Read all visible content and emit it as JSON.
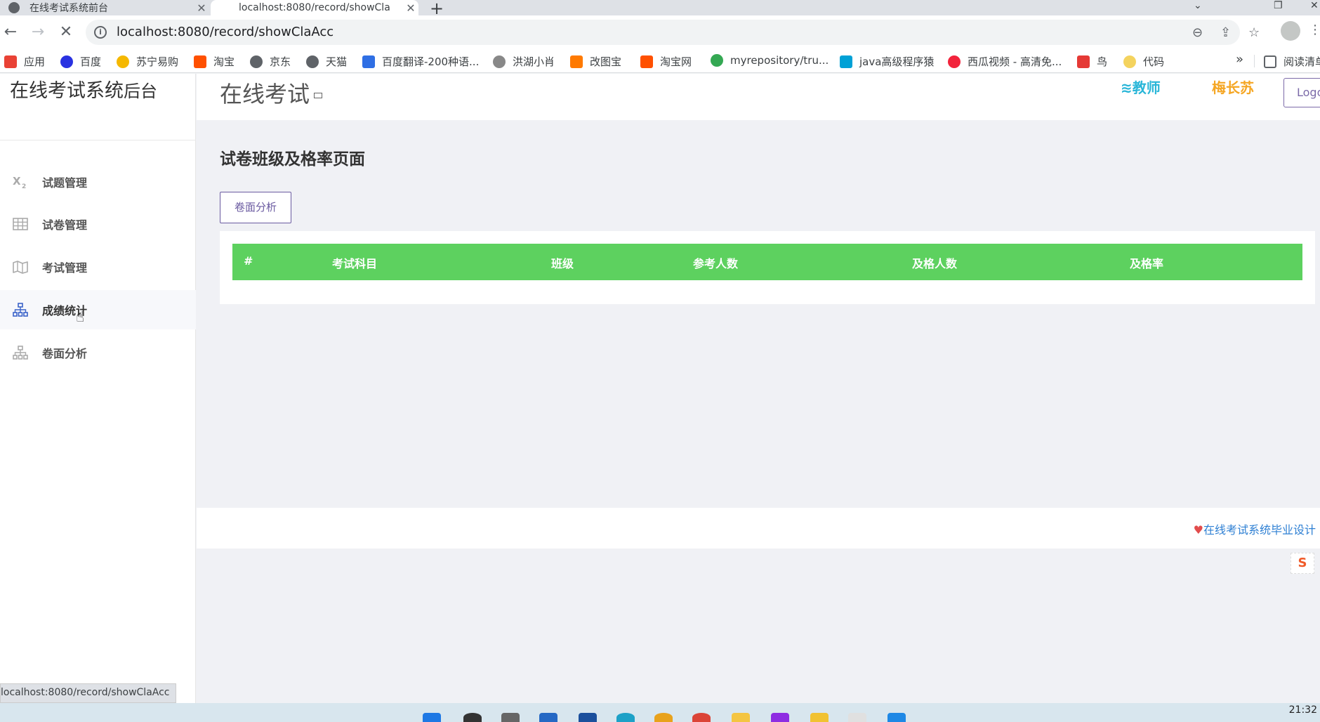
{
  "browser": {
    "tabs": [
      {
        "title": "在线考试系统前台",
        "active": false
      },
      {
        "title": "localhost:8080/record/showCla",
        "active": true
      }
    ],
    "url": "localhost:8080/record/showClaAcc",
    "bookmarks": [
      {
        "label": "应用",
        "color": "#e94235"
      },
      {
        "label": "百度",
        "color": "#2932e1"
      },
      {
        "label": "苏宁易购",
        "color": "#f5b800"
      },
      {
        "label": "淘宝",
        "color": "#ff5000"
      },
      {
        "label": "京东",
        "color": "#5f6368"
      },
      {
        "label": "天猫",
        "color": "#5f6368"
      },
      {
        "label": "百度翻译-200种语...",
        "color": "#2f6fe4"
      },
      {
        "label": "洪湖小肖",
        "color": "#888888"
      },
      {
        "label": "改图宝",
        "color": "#ff7a00"
      },
      {
        "label": "淘宝网",
        "color": "#ff5000"
      },
      {
        "label": "myrepository/tru...",
        "color": "#34a853"
      },
      {
        "label": "java高级程序猿",
        "color": "#00a1d6"
      },
      {
        "label": "西瓜视频 - 高清免...",
        "color": "#f2233b"
      },
      {
        "label": "鸟",
        "color": "#e53935"
      },
      {
        "label": "代码",
        "color": "#f4d35e"
      }
    ],
    "reading_list": "阅读清单",
    "status_url": "localhost:8080/record/showClaAcc"
  },
  "sidebar": {
    "brand": "在线考试系统",
    "brand_sub": "后台",
    "items": [
      {
        "label": "试题管理",
        "icon": "subscript-icon"
      },
      {
        "label": "试卷管理",
        "icon": "grid-icon"
      },
      {
        "label": "考试管理",
        "icon": "map-icon"
      },
      {
        "label": "成绩统计",
        "icon": "sitemap-icon"
      },
      {
        "label": "卷面分析",
        "icon": "sitemap-icon"
      }
    ]
  },
  "header": {
    "title": "在线考试",
    "role": "教师",
    "user": "梅长苏",
    "logout": "Logout"
  },
  "main": {
    "title": "试卷班级及格率页面",
    "analysis_button": "卷面分析",
    "table": {
      "columns": [
        "#",
        "考试科目",
        "班级",
        "参考人数",
        "及格人数",
        "及格率"
      ],
      "rows": []
    }
  },
  "footer": {
    "text": "在线考试系统毕业设计"
  },
  "taskbar": {
    "time": "21:32"
  },
  "colors": {
    "table_header": "#5dd15f",
    "accent_purple": "#6a5aa0",
    "role": "#29b6d8",
    "user": "#f5a623",
    "footer_link": "#2d7fd3"
  }
}
